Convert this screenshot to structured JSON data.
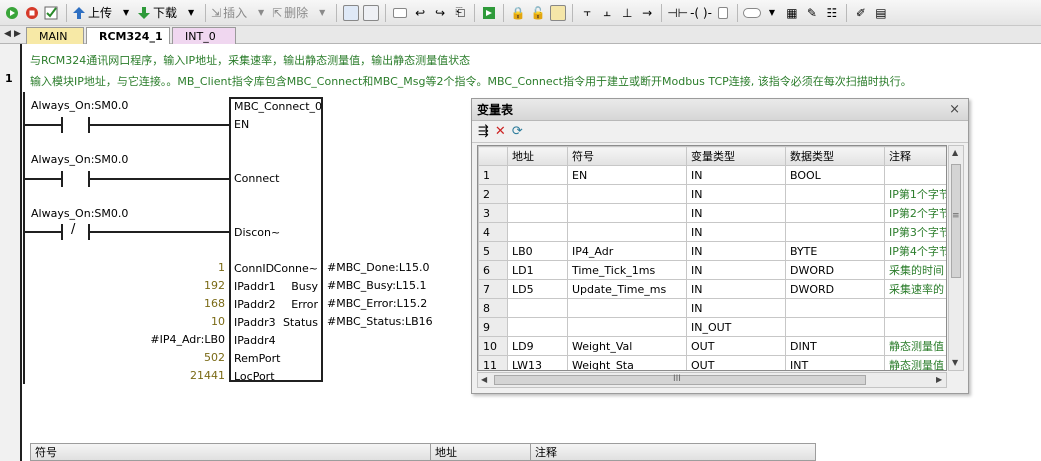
{
  "toolbar": {
    "upload_label": "上传",
    "download_label": "下载",
    "insert_label": "插入",
    "delete_label": "删除"
  },
  "tabs": [
    {
      "label": "MAIN"
    },
    {
      "label": "RCM324_1"
    },
    {
      "label": "INT_0"
    }
  ],
  "editor": {
    "program_comment": "与RCM324通讯网口程序，输入IP地址，采集速率，输出静态测量值，输出静态测量值状态",
    "network_number": "1",
    "network_comment": "输入模块IP地址，与它连接。。MB_Client指令库包含MBC_Connect和MBC_Msg等2个指令。MBC_Connect指令用于建立或断开Modbus TCP连接, 该指令必须在每次扫描时执行。",
    "contacts": [
      {
        "operand": "Always_On:SM0.0",
        "negated": false
      },
      {
        "operand": "Always_On:SM0.0",
        "negated": false
      },
      {
        "operand": "Always_On:SM0.0",
        "negated": true
      }
    ],
    "negate_symbol": "/",
    "block": {
      "name": "MBC_Connect_0",
      "in_bool_pins": [
        "EN",
        "Connect",
        "Discon~"
      ],
      "in_pins": [
        {
          "name": "ConnID",
          "value": "1"
        },
        {
          "name": "IPaddr1",
          "value": "192"
        },
        {
          "name": "IPaddr2",
          "value": "168"
        },
        {
          "name": "IPaddr3",
          "value": "10"
        },
        {
          "name": "IPaddr4",
          "value": "#IP4_Adr:LB0"
        },
        {
          "name": "RemPort",
          "value": "502"
        },
        {
          "name": "LocPort",
          "value": "21441"
        }
      ],
      "out_pins": [
        {
          "name": "Conne~",
          "value": "#MBC_Done:L15.0"
        },
        {
          "name": "Busy",
          "value": "#MBC_Busy:L15.1"
        },
        {
          "name": "Error",
          "value": "#MBC_Error:L15.2"
        },
        {
          "name": "Status",
          "value": "#MBC_Status:LB16"
        }
      ]
    }
  },
  "var_window": {
    "title": "变量表",
    "close_glyph": "×",
    "columns": [
      "",
      "地址",
      "符号",
      "变量类型",
      "数据类型",
      "注释"
    ],
    "rows": [
      [
        "1",
        "",
        "EN",
        "IN",
        "BOOL",
        ""
      ],
      [
        "2",
        "",
        "",
        "IN",
        "",
        "IP第1个字节"
      ],
      [
        "3",
        "",
        "",
        "IN",
        "",
        "IP第2个字节"
      ],
      [
        "4",
        "",
        "",
        "IN",
        "",
        "IP第3个字节"
      ],
      [
        "5",
        "LB0",
        "IP4_Adr",
        "IN",
        "BYTE",
        "IP第4个字节"
      ],
      [
        "6",
        "LD1",
        "Time_Tick_1ms",
        "IN",
        "DWORD",
        "采集的时间"
      ],
      [
        "7",
        "LD5",
        "Update_Time_ms",
        "IN",
        "DWORD",
        "采集速率的"
      ],
      [
        "8",
        "",
        "",
        "IN",
        "",
        ""
      ],
      [
        "9",
        "",
        "",
        "IN_OUT",
        "",
        ""
      ],
      [
        "10",
        "LD9",
        "Weight_Val",
        "OUT",
        "DINT",
        "静态测量值"
      ],
      [
        "11",
        "LW13",
        "Weight_Sta",
        "OUT",
        "INT",
        "静态测量值"
      ]
    ],
    "scroll_grip": "≡",
    "hscroll_grip": "III"
  },
  "bottom_table": {
    "columns": [
      "符号",
      "地址",
      "注释"
    ]
  }
}
